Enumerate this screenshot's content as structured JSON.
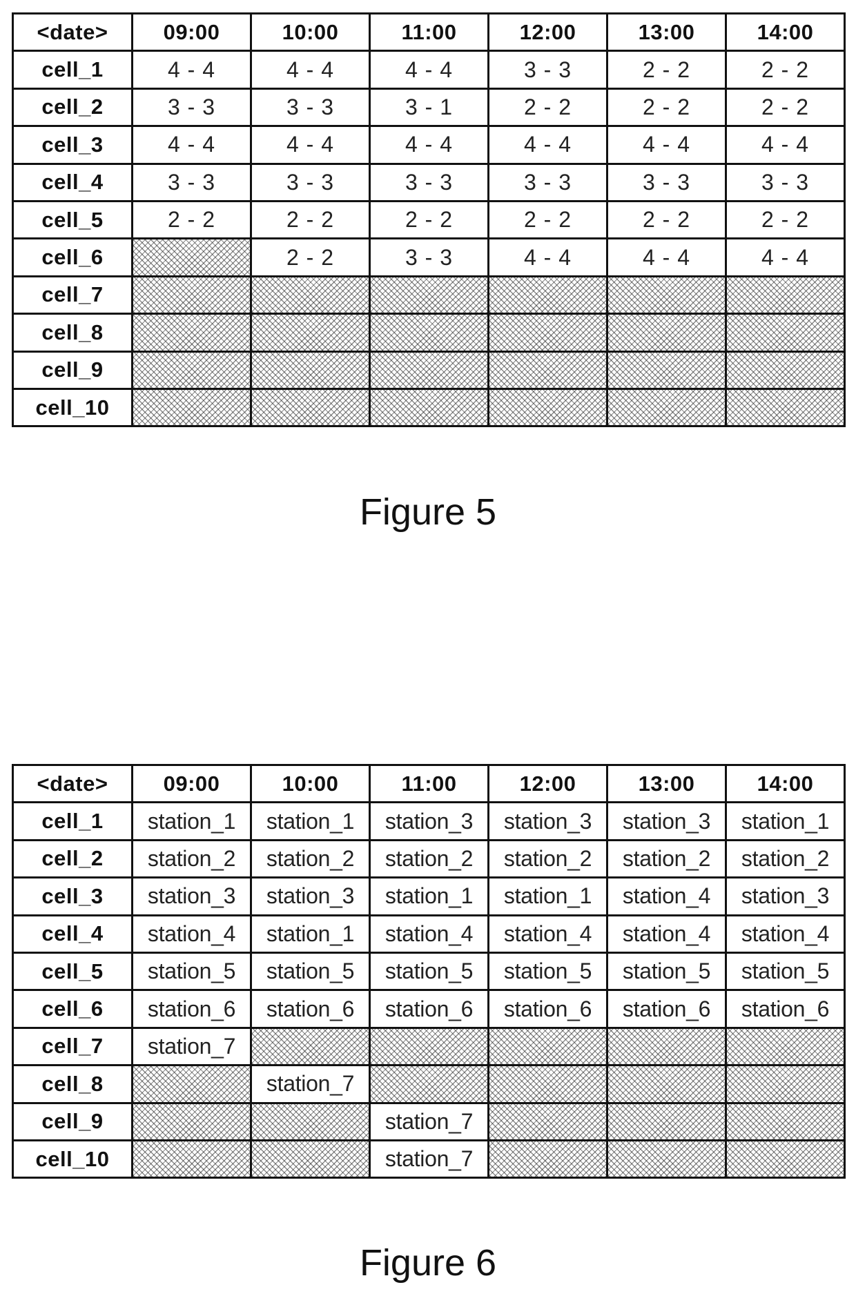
{
  "figures": [
    {
      "caption": "Figure 5",
      "table": {
        "corner_header": "<date>",
        "columns": [
          "09:00",
          "10:00",
          "11:00",
          "12:00",
          "13:00",
          "14:00"
        ],
        "rows": [
          {
            "label": "cell_1",
            "values": [
              "4 - 4",
              "4 - 4",
              "4 - 4",
              "3 - 3",
              "2 - 2",
              "2 - 2"
            ]
          },
          {
            "label": "cell_2",
            "values": [
              "3 - 3",
              "3 - 3",
              "3 - 1",
              "2 - 2",
              "2 - 2",
              "2 - 2"
            ]
          },
          {
            "label": "cell_3",
            "values": [
              "4 - 4",
              "4 - 4",
              "4 - 4",
              "4 - 4",
              "4 - 4",
              "4 - 4"
            ]
          },
          {
            "label": "cell_4",
            "values": [
              "3 - 3",
              "3 - 3",
              "3 - 3",
              "3 - 3",
              "3 - 3",
              "3 - 3"
            ]
          },
          {
            "label": "cell_5",
            "values": [
              "2 - 2",
              "2 - 2",
              "2 - 2",
              "2 - 2",
              "2 - 2",
              "2 - 2"
            ]
          },
          {
            "label": "cell_6",
            "values": [
              null,
              "2 - 2",
              "3 - 3",
              "4 - 4",
              "4 - 4",
              "4 - 4"
            ]
          },
          {
            "label": "cell_7",
            "values": [
              null,
              null,
              null,
              null,
              null,
              null
            ]
          },
          {
            "label": "cell_8",
            "values": [
              null,
              null,
              null,
              null,
              null,
              null
            ]
          },
          {
            "label": "cell_9",
            "values": [
              null,
              null,
              null,
              null,
              null,
              null
            ]
          },
          {
            "label": "cell_10",
            "values": [
              null,
              null,
              null,
              null,
              null,
              null
            ]
          }
        ],
        "empty_cell_style": "hatched"
      }
    },
    {
      "caption": "Figure 6",
      "table": {
        "corner_header": "<date>",
        "columns": [
          "09:00",
          "10:00",
          "11:00",
          "12:00",
          "13:00",
          "14:00"
        ],
        "rows": [
          {
            "label": "cell_1",
            "values": [
              "station_1",
              "station_1",
              "station_3",
              "station_3",
              "station_3",
              "station_1"
            ]
          },
          {
            "label": "cell_2",
            "values": [
              "station_2",
              "station_2",
              "station_2",
              "station_2",
              "station_2",
              "station_2"
            ]
          },
          {
            "label": "cell_3",
            "values": [
              "station_3",
              "station_3",
              "station_1",
              "station_1",
              "station_4",
              "station_3"
            ]
          },
          {
            "label": "cell_4",
            "values": [
              "station_4",
              "station_1",
              "station_4",
              "station_4",
              "station_4",
              "station_4"
            ]
          },
          {
            "label": "cell_5",
            "values": [
              "station_5",
              "station_5",
              "station_5",
              "station_5",
              "station_5",
              "station_5"
            ]
          },
          {
            "label": "cell_6",
            "values": [
              "station_6",
              "station_6",
              "station_6",
              "station_6",
              "station_6",
              "station_6"
            ]
          },
          {
            "label": "cell_7",
            "values": [
              "station_7",
              null,
              null,
              null,
              null,
              null
            ]
          },
          {
            "label": "cell_8",
            "values": [
              null,
              "station_7",
              null,
              null,
              null,
              null
            ]
          },
          {
            "label": "cell_9",
            "values": [
              null,
              null,
              "station_7",
              null,
              null,
              null
            ]
          },
          {
            "label": "cell_10",
            "values": [
              null,
              null,
              "station_7",
              null,
              null,
              null
            ]
          }
        ],
        "empty_cell_style": "hatched"
      }
    }
  ]
}
